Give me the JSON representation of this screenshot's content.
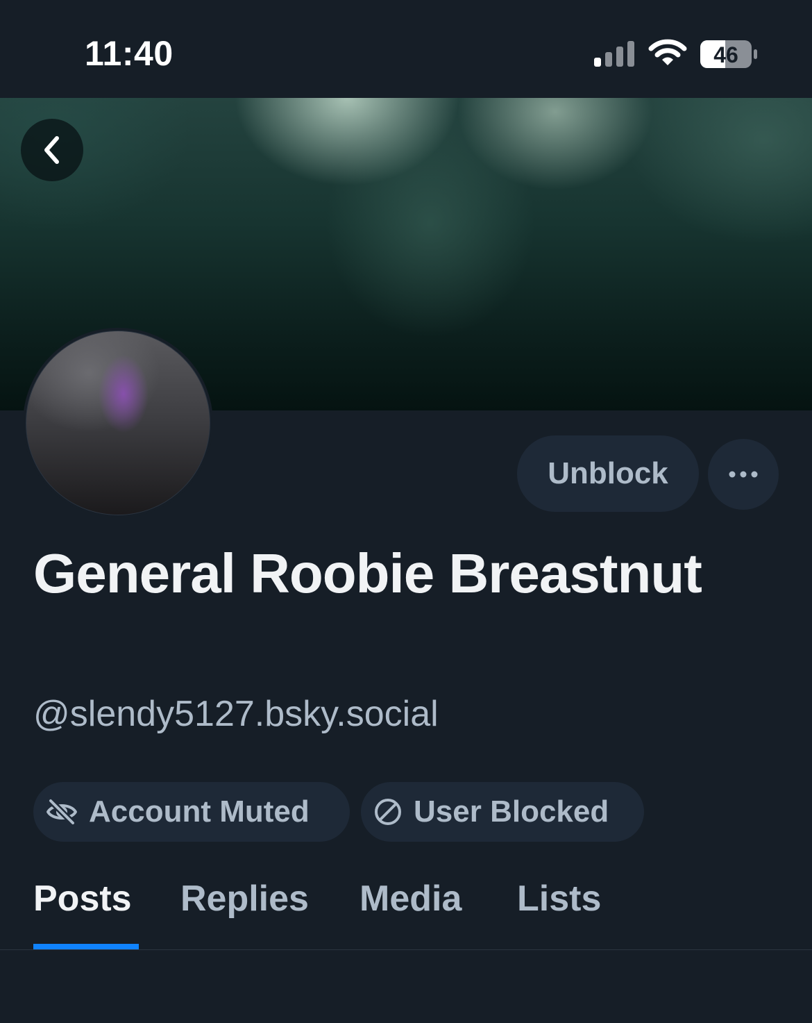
{
  "status_bar": {
    "time": "11:40",
    "battery": "46"
  },
  "profile": {
    "display_name": "General Roobie Breastnut",
    "handle": "@slendy5127.bsky.social"
  },
  "actions": {
    "unblock_label": "Unblock",
    "more_icon": "ellipsis-icon"
  },
  "badges": [
    {
      "label": "Account Muted",
      "icon": "eye-slash-icon"
    },
    {
      "label": "User Blocked",
      "icon": "circle-slash-icon"
    }
  ],
  "tabs": [
    {
      "label": "Posts",
      "active": true
    },
    {
      "label": "Replies",
      "active": false
    },
    {
      "label": "Media",
      "active": false
    },
    {
      "label": "Lists",
      "active": false
    }
  ],
  "colors": {
    "background": "#161e27",
    "button_bg": "#1e2937",
    "muted_text": "#aebbc9",
    "accent": "#1083fe"
  }
}
